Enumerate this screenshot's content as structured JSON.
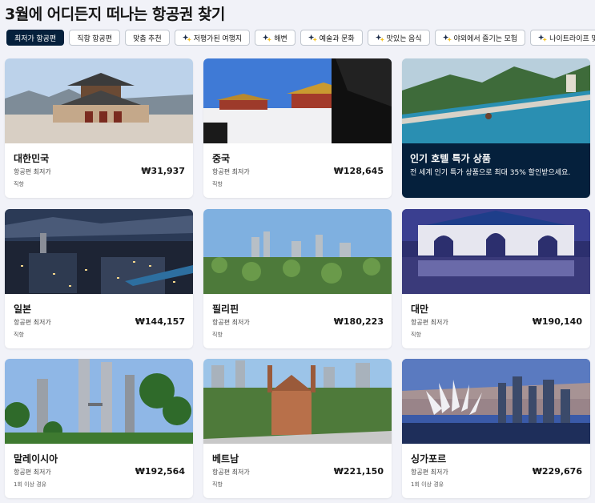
{
  "page": {
    "title": "3월에 어디든지 떠나는 항공권 찾기"
  },
  "filters": [
    {
      "label": "최저가 항공편",
      "icon": "",
      "active": true
    },
    {
      "label": "직항 항공편",
      "icon": "",
      "active": false
    },
    {
      "label": "맞춤 추천",
      "icon": "",
      "active": false
    },
    {
      "label": "저평가된 여행지",
      "icon": "sparkle-icon",
      "active": false
    },
    {
      "label": "해변",
      "icon": "sparkle-icon",
      "active": false
    },
    {
      "label": "예술과 문화",
      "icon": "sparkle-icon",
      "active": false
    },
    {
      "label": "맛있는 음식",
      "icon": "sparkle-icon",
      "active": false
    },
    {
      "label": "야외에서 즐기는 모험",
      "icon": "sparkle-icon",
      "active": false
    },
    {
      "label": "나이트라이프 및 엔터",
      "icon": "sparkle-icon",
      "active": false
    }
  ],
  "colors": {
    "accent": "#05203c",
    "background": "#f1f2f8",
    "card": "#ffffff"
  },
  "cards": [
    {
      "name": "대한민국",
      "sub": "항공편 최저가",
      "price": "₩31,937",
      "note": "직항"
    },
    {
      "name": "중국",
      "sub": "항공편 최저가",
      "price": "₩128,645",
      "note": "직항"
    },
    {
      "promo": true,
      "name": "인기 호텔 특가 상품",
      "desc": "전 세계 인기 특가 상품으로 최대 35% 할인받으세요."
    },
    {
      "name": "일본",
      "sub": "항공편 최저가",
      "price": "₩144,157",
      "note": "직항"
    },
    {
      "name": "필리핀",
      "sub": "항공편 최저가",
      "price": "₩180,223",
      "note": "직항"
    },
    {
      "name": "대만",
      "sub": "항공편 최저가",
      "price": "₩190,140",
      "note": "직항"
    },
    {
      "name": "말레이시아",
      "sub": "항공편 최저가",
      "price": "₩192,564",
      "note": "1회 이상 경유"
    },
    {
      "name": "베트남",
      "sub": "항공편 최저가",
      "price": "₩221,150",
      "note": "직항"
    },
    {
      "name": "싱가포르",
      "sub": "항공편 최저가",
      "price": "₩229,676",
      "note": "1회 이상 경유"
    }
  ]
}
